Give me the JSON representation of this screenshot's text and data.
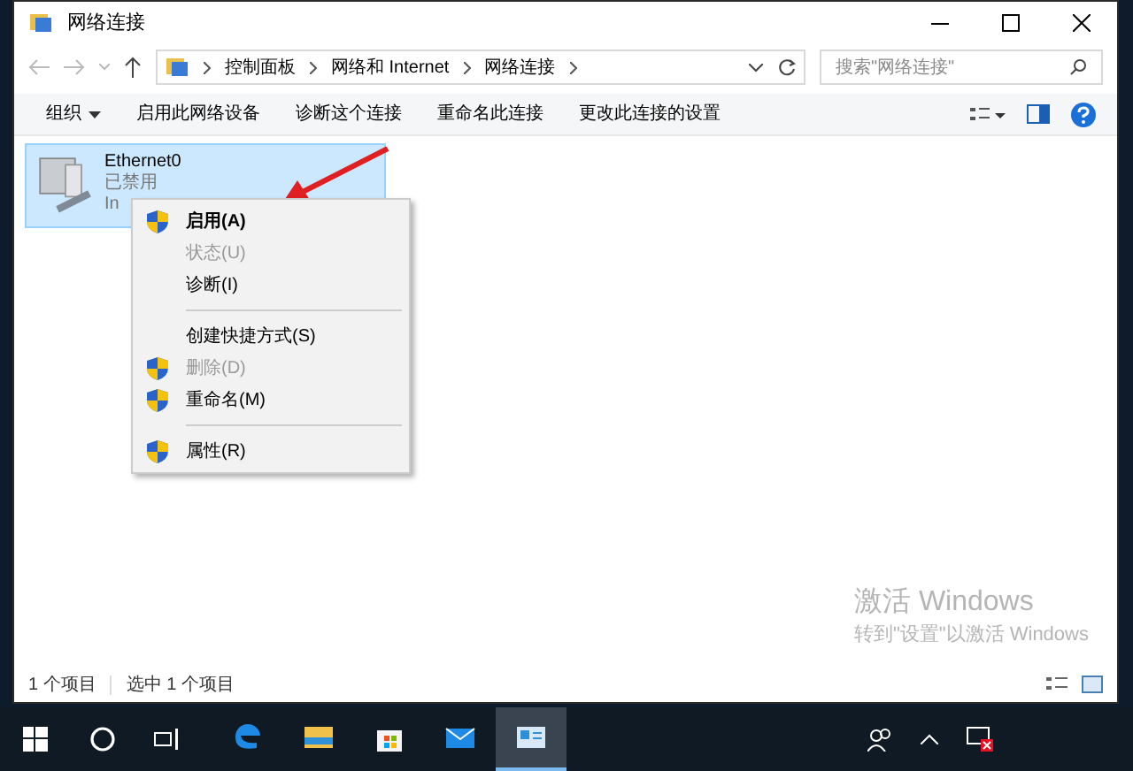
{
  "window": {
    "title": "网络连接"
  },
  "address": {
    "crumbs": [
      "控制面板",
      "网络和 Internet",
      "网络连接"
    ]
  },
  "search": {
    "placeholder": "搜索\"网络连接\""
  },
  "toolbar": [
    {
      "label": "组织",
      "dropdown": true
    },
    {
      "label": "启用此网络设备",
      "dropdown": false
    },
    {
      "label": "诊断这个连接",
      "dropdown": false
    },
    {
      "label": "重命名此连接",
      "dropdown": false
    },
    {
      "label": "更改此连接的设置",
      "dropdown": false
    }
  ],
  "connection": {
    "name": "Ethernet0",
    "status": "已禁用",
    "detail": "In",
    "selected": true
  },
  "context_menu": [
    {
      "kind": "item",
      "label": "启用(A)",
      "shield": true,
      "default": true,
      "disabled": false
    },
    {
      "kind": "item",
      "label": "状态(U)",
      "shield": false,
      "default": false,
      "disabled": true
    },
    {
      "kind": "item",
      "label": "诊断(I)",
      "shield": false,
      "default": false,
      "disabled": false
    },
    {
      "kind": "separator"
    },
    {
      "kind": "item",
      "label": "创建快捷方式(S)",
      "shield": false,
      "default": false,
      "disabled": false
    },
    {
      "kind": "item",
      "label": "删除(D)",
      "shield": true,
      "default": false,
      "disabled": true
    },
    {
      "kind": "item",
      "label": "重命名(M)",
      "shield": true,
      "default": false,
      "disabled": false
    },
    {
      "kind": "separator"
    },
    {
      "kind": "item",
      "label": "属性(R)",
      "shield": true,
      "default": false,
      "disabled": false
    }
  ],
  "status_bar": [
    "1 个项目",
    "选中 1 个项目"
  ],
  "activation": {
    "title": "激活 Windows",
    "subtitle": "转到\"设置\"以激活 Windows"
  },
  "taskbar": [
    {
      "kind": "edge",
      "active": false
    },
    {
      "kind": "folder",
      "active": false
    },
    {
      "kind": "store",
      "active": false
    },
    {
      "kind": "mail",
      "active": false
    },
    {
      "kind": "network",
      "active": true
    }
  ]
}
